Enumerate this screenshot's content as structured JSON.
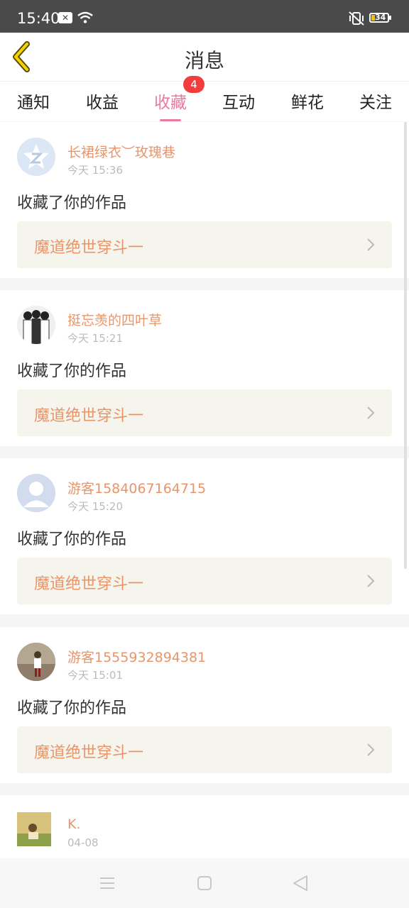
{
  "status": {
    "time": "15:40",
    "battery": "34"
  },
  "header": {
    "title": "消息"
  },
  "tabs": [
    {
      "label": "通知"
    },
    {
      "label": "收益"
    },
    {
      "label": "收藏",
      "badge": "4",
      "active": true
    },
    {
      "label": "互动"
    },
    {
      "label": "鲜花"
    },
    {
      "label": "关注"
    }
  ],
  "items": [
    {
      "user": "长裙绿衣︶玫瑰巷",
      "time": "今天 15:36",
      "action": "收藏了你的作品",
      "work": "魔道绝世穿斗一"
    },
    {
      "user": "挺忘羡的四叶草",
      "time": "今天 15:21",
      "action": "收藏了你的作品",
      "work": "魔道绝世穿斗一"
    },
    {
      "user": "游客1584067164715",
      "time": "今天 15:20",
      "action": "收藏了你的作品",
      "work": "魔道绝世穿斗一"
    },
    {
      "user": "游客1555932894381",
      "time": "今天 15:01",
      "action": "收藏了你的作品",
      "work": "魔道绝世穿斗一"
    },
    {
      "user": "K.",
      "time": "04-08"
    }
  ],
  "colors": {
    "accent": "#e97aa0",
    "username": "#e8956a",
    "badge": "#f23d3d",
    "work_bg": "#f6f5ed"
  }
}
